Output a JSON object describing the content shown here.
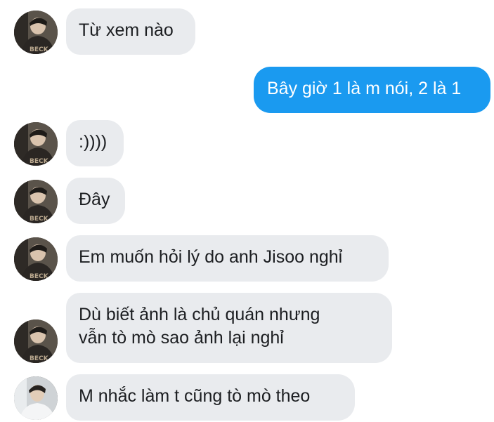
{
  "chat": {
    "messages": [
      {
        "sender": "them",
        "text": "Từ xem nào",
        "avatar_icon": "person-photo-avatar-dark"
      },
      {
        "sender": "me",
        "text": "Bây giờ 1 là m nói, 2 là 1"
      },
      {
        "sender": "them",
        "text": ":))))",
        "avatar_icon": "person-photo-avatar-dark"
      },
      {
        "sender": "them",
        "text": "Đây",
        "avatar_icon": "person-photo-avatar-dark"
      },
      {
        "sender": "them",
        "text": "Em muốn hỏi lý do anh Jisoo nghỉ",
        "avatar_icon": "person-photo-avatar-dark"
      },
      {
        "sender": "them",
        "lines": [
          "Dù biết ảnh là chủ quán nhưng",
          "vẫn tò mò sao ảnh lại nghỉ"
        ],
        "avatar_icon": "person-photo-avatar-dark"
      },
      {
        "sender": "them",
        "text": "M nhắc làm t cũng tò mò theo",
        "avatar_icon": "person-photo-avatar-light"
      }
    ]
  },
  "colors": {
    "incoming_bubble": "#e9ebee",
    "outgoing_bubble": "#1a9af0",
    "incoming_text": "#1c1e21",
    "outgoing_text": "#ffffff"
  }
}
